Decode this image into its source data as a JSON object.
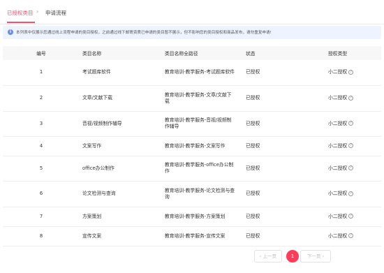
{
  "tabs": {
    "active": "已授权类目",
    "separator": "›",
    "second": "申请流程"
  },
  "notice": {
    "icon": "info-icon",
    "text": "本列表中仅展示您通过线上流程申请的类目授权，之前通过线下邮寄资质已申请的类目暂不展示，但不影响您的类目授权和商品发布，请勿重复申请!"
  },
  "table": {
    "headers": {
      "no": "编号",
      "name": "类目名称",
      "path": "类目名称全路径",
      "status": "状态",
      "type": "授权类型"
    },
    "rows": [
      {
        "no": "1",
        "name": "考试题库软件",
        "path": "教育培训-教学服务-考试题库软件",
        "status": "已授权",
        "type": "小二授权"
      },
      {
        "no": "2",
        "name": "文章/文献下载",
        "path": "教育培训-教学服务-文章/文献下载",
        "status": "已授权",
        "type": "小二授权"
      },
      {
        "no": "3",
        "name": "音视/视频制作辅导",
        "path": "教育培训-教学服务-音视/视频制作辅导",
        "status": "已授权",
        "type": "小二授权"
      },
      {
        "no": "4",
        "name": "文案写作",
        "path": "教育培训-教学服务-文案写作",
        "status": "已授权",
        "type": "小二授权"
      },
      {
        "no": "5",
        "name": "office办公制作",
        "path": "教育培训-教学服务-office办公制作",
        "status": "已授权",
        "type": "小二授权"
      },
      {
        "no": "6",
        "name": "论文检测与查询",
        "path": "教育培训-教学服务-论文检测与查询",
        "status": "已授权",
        "type": "小二授权"
      },
      {
        "no": "7",
        "name": "方案策划",
        "path": "教育培训-教学服务-方案策划",
        "status": "已授权",
        "type": "小二授权"
      },
      {
        "no": "8",
        "name": "宣传文案",
        "path": "教育培训-教学服务-宣传文案",
        "status": "已授权",
        "type": "小二授权"
      }
    ]
  },
  "pagination": {
    "prev": "‹ 上一页",
    "current": "1",
    "next": "下一页 ›"
  },
  "colors": {
    "accent": "#ff3d5a",
    "notice_bg": "#eef4ff"
  }
}
